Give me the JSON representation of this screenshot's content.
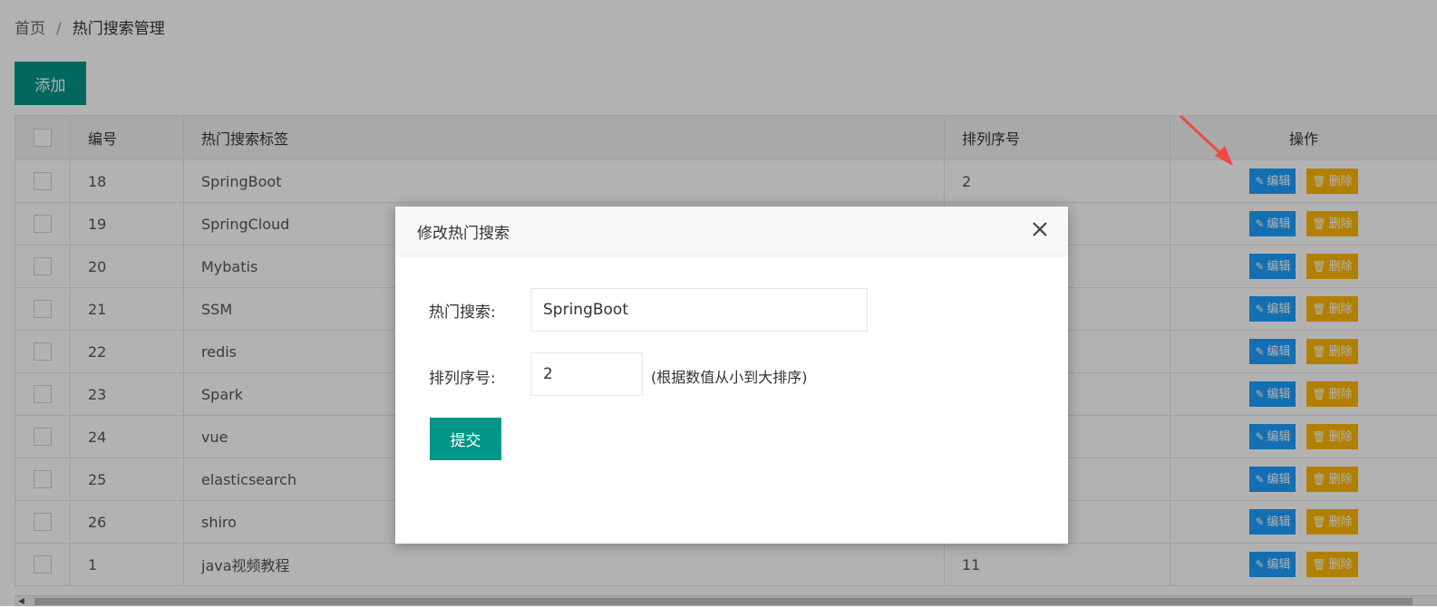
{
  "breadcrumb": {
    "home": "首页",
    "separator": "/",
    "current": "热门搜索管理"
  },
  "toolbar": {
    "add_label": "添加"
  },
  "table": {
    "headers": {
      "id": "编号",
      "tag": "热门搜索标签",
      "order": "排列序号",
      "ops": "操作"
    },
    "actions": {
      "edit": "编辑",
      "delete": "删除"
    },
    "rows": [
      {
        "id": "18",
        "tag": "SpringBoot",
        "order": "2"
      },
      {
        "id": "19",
        "tag": "SpringCloud",
        "order": ""
      },
      {
        "id": "20",
        "tag": "Mybatis",
        "order": ""
      },
      {
        "id": "21",
        "tag": "SSM",
        "order": ""
      },
      {
        "id": "22",
        "tag": "redis",
        "order": ""
      },
      {
        "id": "23",
        "tag": "Spark",
        "order": ""
      },
      {
        "id": "24",
        "tag": "vue",
        "order": ""
      },
      {
        "id": "25",
        "tag": "elasticsearch",
        "order": ""
      },
      {
        "id": "26",
        "tag": "shiro",
        "order": ""
      },
      {
        "id": "1",
        "tag": "java视频教程",
        "order": "11"
      }
    ]
  },
  "modal": {
    "title": "修改热门搜索",
    "fields": {
      "search_label": "热门搜索:",
      "search_value": "SpringBoot",
      "order_label": "排列序号:",
      "order_value": "2",
      "order_hint": "(根据数值从小到大排序)"
    },
    "submit_label": "提交"
  },
  "colors": {
    "primary": "#009688",
    "edit": "#1E9FFF",
    "delete": "#FFB800",
    "annotation_arrow": "#f04844"
  }
}
